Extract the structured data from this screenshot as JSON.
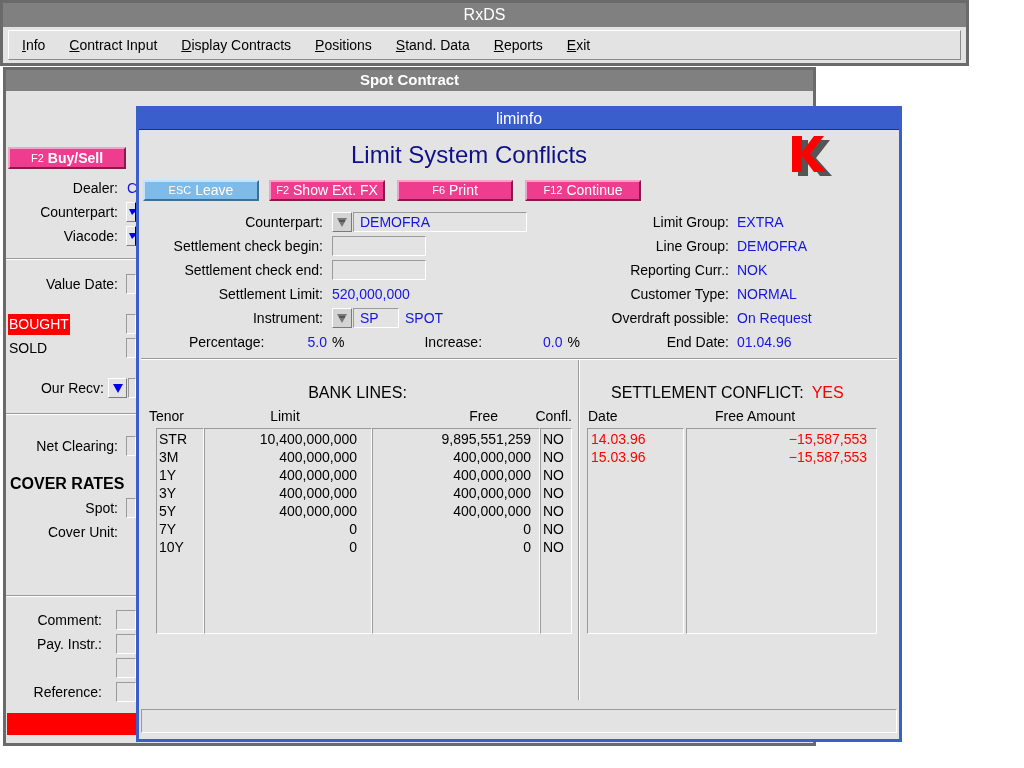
{
  "app_window": {
    "title": "RxDS",
    "menu": [
      "Info",
      "Contract Input",
      "Display Contracts",
      "Positions",
      "Stand. Data",
      "Reports",
      "Exit"
    ]
  },
  "spot_window": {
    "title": "Spot Contract",
    "rows": [
      {
        "kind": "button",
        "key": "F2",
        "label": "Buy/Sell"
      },
      {
        "kind": "field",
        "label": "Dealer:",
        "value": "C"
      },
      {
        "kind": "dropdown",
        "label": "Counterpart:"
      },
      {
        "kind": "dropdown",
        "label": "Viacode:"
      },
      {
        "kind": "divider"
      },
      {
        "kind": "field",
        "label": "Value Date:"
      },
      {
        "kind": "option",
        "label": "BOUGHT",
        "selected": true
      },
      {
        "kind": "option",
        "label": "SOLD",
        "selected": false
      },
      {
        "kind": "select",
        "label": "Our Recv:"
      },
      {
        "kind": "divider"
      },
      {
        "kind": "field",
        "label": "Net Clearing:"
      },
      {
        "kind": "heading",
        "label": "COVER RATES"
      },
      {
        "kind": "field",
        "label": "Spot:"
      },
      {
        "kind": "plain",
        "label": "Cover Unit:"
      },
      {
        "kind": "divider"
      },
      {
        "kind": "note",
        "label": "Comment:"
      },
      {
        "kind": "note",
        "label": "Pay. Instr.:"
      },
      {
        "kind": "note"
      },
      {
        "kind": "note",
        "label": "Reference:"
      }
    ]
  },
  "dialog": {
    "title": "liminfo",
    "heading": "Limit System Conflicts",
    "buttons": [
      {
        "key": "ESC",
        "label": "Leave",
        "kind": "leave"
      },
      {
        "key": "F2",
        "label": "Show Ext. FX",
        "kind": "action"
      },
      {
        "key": "F6",
        "label": "Print",
        "kind": "action"
      },
      {
        "key": "F12",
        "label": "Continue",
        "kind": "action"
      }
    ],
    "left_fields": [
      {
        "kind": "combo",
        "label": "Counterpart:",
        "value": "DEMOFRA"
      },
      {
        "kind": "input",
        "label": "Settlement check begin:"
      },
      {
        "kind": "input",
        "label": "Settlement check end:"
      },
      {
        "kind": "text",
        "label": "Settlement Limit:",
        "value": "520,000,000"
      },
      {
        "kind": "code",
        "label": "Instrument:",
        "value": "SP",
        "description": "SPOT"
      },
      {
        "kind": "pair",
        "items": [
          {
            "label": "Percentage:",
            "value": "5.0",
            "unit": "%"
          },
          {
            "label": "Increase:",
            "value": "0.0",
            "unit": "%"
          }
        ]
      }
    ],
    "right_fields": [
      {
        "label": "Limit Group:",
        "value": "EXTRA"
      },
      {
        "label": "Line  Group:",
        "value": "DEMOFRA"
      },
      {
        "label": "Reporting Curr.:",
        "value": "NOK"
      },
      {
        "label": "Customer Type:",
        "value": "NORMAL"
      },
      {
        "label": "Overdraft possible:",
        "value": "On Request"
      },
      {
        "label": "End Date:",
        "value": "01.04.96"
      }
    ],
    "bank_lines": {
      "title": "BANK LINES:",
      "columns": [
        "Tenor",
        "Limit",
        "Free",
        "Confl."
      ],
      "rows": [
        [
          "STR",
          "10,400,000,000",
          "9,895,551,259",
          "NO"
        ],
        [
          "3M",
          "400,000,000",
          "400,000,000",
          "NO"
        ],
        [
          "1Y",
          "400,000,000",
          "400,000,000",
          "NO"
        ],
        [
          "3Y",
          "400,000,000",
          "400,000,000",
          "NO"
        ],
        [
          "5Y",
          "400,000,000",
          "400,000,000",
          "NO"
        ],
        [
          "7Y",
          "0",
          "0",
          "NO"
        ],
        [
          "10Y",
          "0",
          "0",
          "NO"
        ]
      ]
    },
    "settlement_conflict": {
      "title": "SETTLEMENT CONFLICT:",
      "value": "YES",
      "columns": [
        "Date",
        "Free Amount"
      ],
      "rows": [
        [
          "14.03.96",
          "−15,587,553"
        ],
        [
          "15.03.96",
          "−15,587,553"
        ]
      ]
    }
  }
}
